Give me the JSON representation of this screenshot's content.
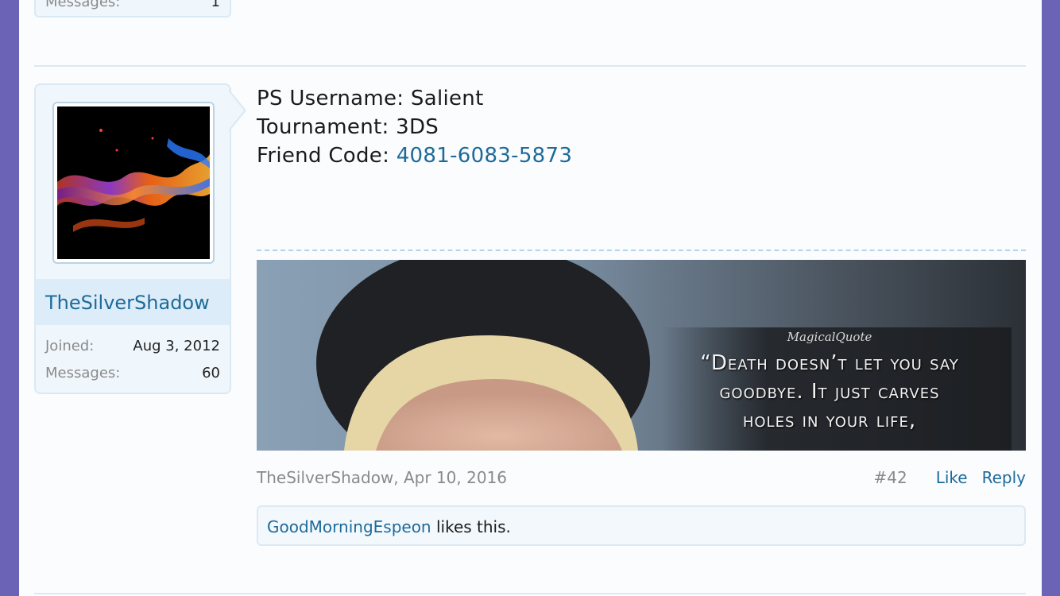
{
  "prev_post": {
    "messages_label": "Messages:",
    "messages_value": "1"
  },
  "post": {
    "user": {
      "name": "TheSilverShadow",
      "joined_label": "Joined:",
      "joined_value": "Aug 3, 2012",
      "messages_label": "Messages:",
      "messages_value": "60"
    },
    "body": {
      "line1": "PS Username: Salient",
      "line2": "Tournament: 3DS",
      "line3_label": "Friend Code: ",
      "line3_value": "4081-6083-5873"
    },
    "signature": {
      "logo": "MagicalQuote",
      "quote_lines": [
        "“Death doesn’t let you say",
        "goodbye. It just carves",
        "holes in your life,"
      ]
    },
    "meta": {
      "author_date": "TheSilverShadow, Apr 10, 2016",
      "number": "#42",
      "like": "Like",
      "reply": "Reply"
    },
    "likes": {
      "liker": "GoodMorningEspeon",
      "suffix": " likes this."
    }
  },
  "colors": {
    "accent": "#1d6a9a",
    "frame": "#6b63b5",
    "panel": "#f0f7fc"
  }
}
